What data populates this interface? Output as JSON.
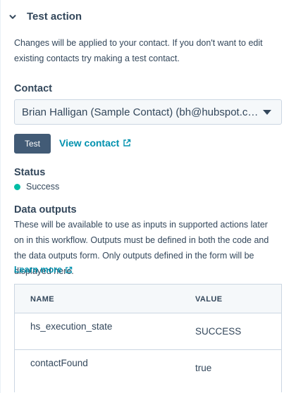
{
  "section": {
    "title": "Test action",
    "description": "Changes will be applied to your contact. If you don't want to edit existing contacts try making a test contact."
  },
  "contact": {
    "label": "Contact",
    "selected_value": "Brian Halligan (Sample Contact) (bh@hubspot.com)",
    "test_button_label": "Test",
    "view_contact_label": "View contact"
  },
  "status": {
    "label": "Status",
    "value": "Success"
  },
  "data_outputs": {
    "label": "Data outputs",
    "description": "These will be available to use as inputs in supported actions later on in this workflow. Outputs must be defined in both the code and the data outputs form. Only outputs defined in the form will be displayed here.",
    "learn_more_label": "Learn more",
    "table": {
      "headers": [
        "NAME",
        "VALUE"
      ],
      "rows": [
        {
          "name": "hs_execution_state",
          "value": "SUCCESS"
        },
        {
          "name": "contactFound",
          "value": "true"
        }
      ]
    }
  },
  "icons": {
    "collapse": "chevron-down-icon",
    "external": "external-link-icon",
    "dropdown": "caret-down-icon",
    "status": "status-dot-icon"
  },
  "colors": {
    "text": "#33475b",
    "link": "#0091ae",
    "button": "#425b76",
    "success": "#00bda5",
    "border": "#cbd6e2",
    "panel": "#f5f8fa"
  }
}
